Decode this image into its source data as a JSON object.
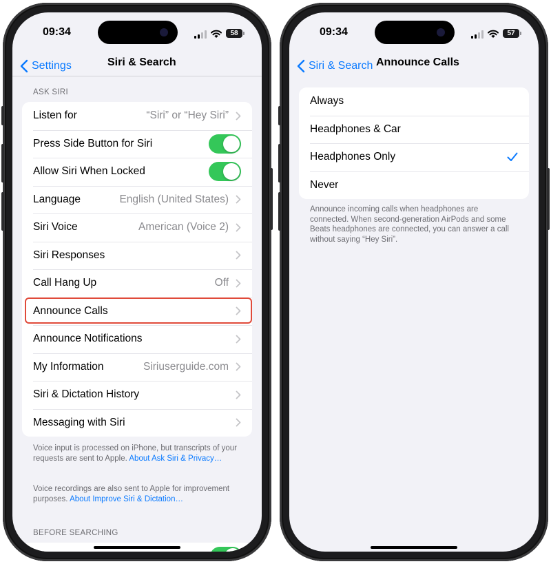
{
  "status": {
    "time": "09:34",
    "battery_left": "58",
    "battery_right": "57"
  },
  "left": {
    "back_label": "Settings",
    "title": "Siri & Search",
    "section_ask_siri": "ASK SIRI",
    "rows": [
      {
        "label": "Listen for",
        "value": "“Siri” or “Hey Siri”"
      },
      {
        "label": "Press Side Button for Siri"
      },
      {
        "label": "Allow Siri When Locked"
      },
      {
        "label": "Language",
        "value": "English (United States)"
      },
      {
        "label": "Siri Voice",
        "value": "American (Voice 2)"
      },
      {
        "label": "Siri Responses"
      },
      {
        "label": "Call Hang Up",
        "value": "Off"
      },
      {
        "label": "Announce Calls"
      },
      {
        "label": "Announce Notifications"
      },
      {
        "label": "My Information",
        "value": "Siriuserguide.com"
      },
      {
        "label": "Siri & Dictation History"
      },
      {
        "label": "Messaging with Siri"
      }
    ],
    "footer1_text": "Voice input is processed on iPhone, but transcripts of your requests are sent to Apple.",
    "footer1_link": "About Ask Siri & Privacy…",
    "footer2_text": "Voice recordings are also sent to Apple for improvement purposes.",
    "footer2_link": "About Improve Siri & Dictation…",
    "section_before_searching": "BEFORE SEARCHING"
  },
  "right": {
    "back_label": "Siri & Search",
    "title": "Announce Calls",
    "options": [
      {
        "label": "Always"
      },
      {
        "label": "Headphones & Car"
      },
      {
        "label": "Headphones Only",
        "selected": true
      },
      {
        "label": "Never"
      }
    ],
    "footer": "Announce incoming calls when headphones are connected. When second-generation AirPods and some Beats headphones are connected, you can answer a call without saying “Hey Siri”."
  },
  "colors": {
    "accent": "#0a7aff",
    "toggle_on": "#34c759",
    "highlight": "#e04a3a",
    "background": "#f2f2f7"
  }
}
